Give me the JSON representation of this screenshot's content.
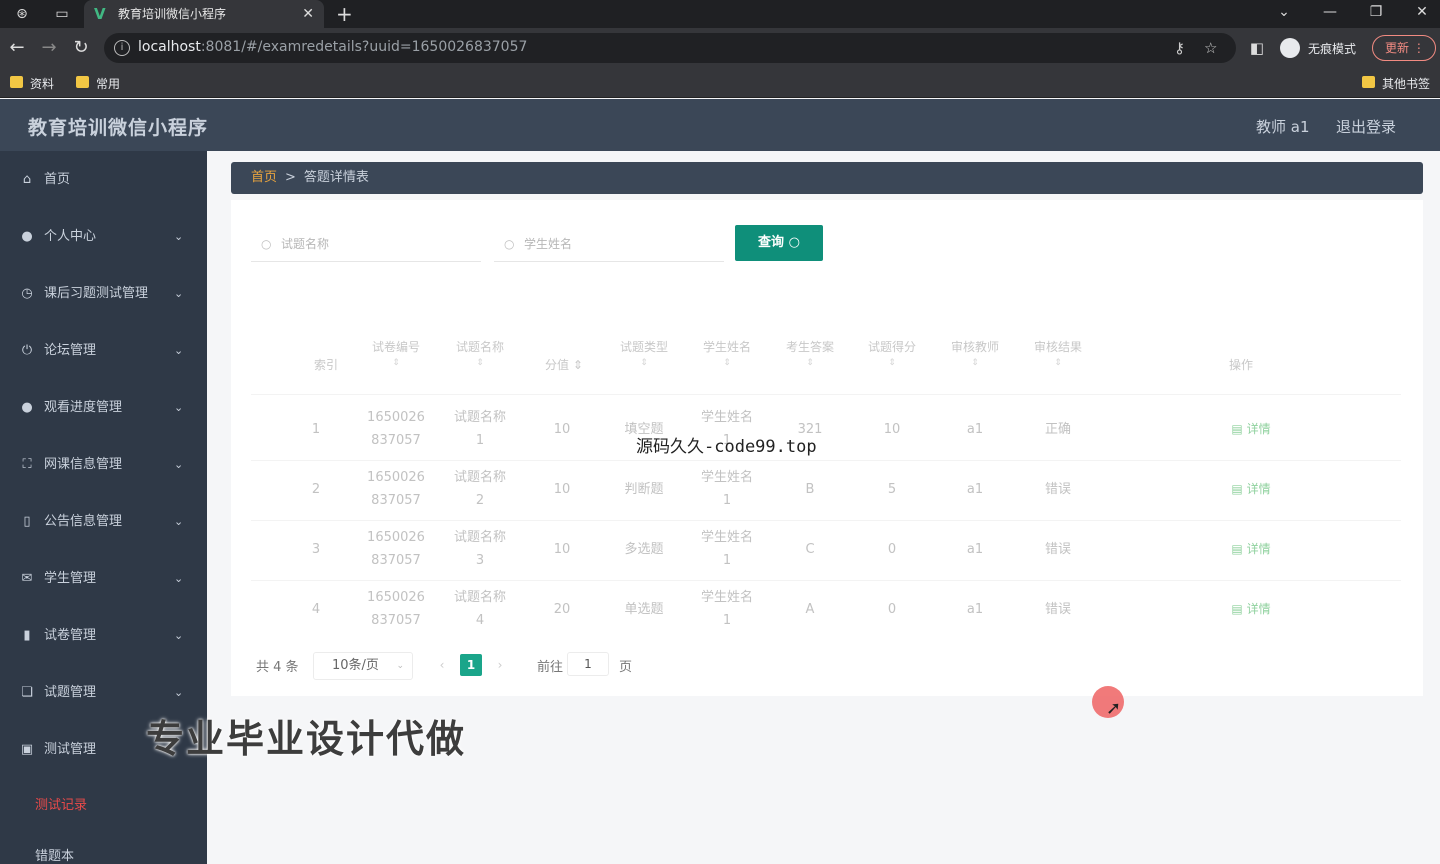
{
  "browser": {
    "tab_title": "教育培训微信小程序",
    "url_host": "localhost",
    "url_rest": ":8081/#/examredetails?uuid=1650026837057",
    "incognito_label": "无痕模式",
    "update_label": "更新",
    "bookmarks": [
      "资料",
      "常用"
    ],
    "other_bookmarks": "其他书签"
  },
  "header": {
    "title": "教育培训微信小程序",
    "user": "教师 a1",
    "logout": "退出登录"
  },
  "sidebar": {
    "items": [
      {
        "label": "首页"
      },
      {
        "label": "个人中心"
      },
      {
        "label": "课后习题测试管理"
      },
      {
        "label": "论坛管理"
      },
      {
        "label": "观看进度管理"
      },
      {
        "label": "网课信息管理"
      },
      {
        "label": "公告信息管理"
      },
      {
        "label": "学生管理"
      },
      {
        "label": "试卷管理"
      },
      {
        "label": "试题管理"
      },
      {
        "label": "测试管理"
      }
    ],
    "sub_items": [
      "测试记录",
      "错题本"
    ]
  },
  "breadcrumb": {
    "home": "首页",
    "sep": ">",
    "current": "答题详情表"
  },
  "search": {
    "question_placeholder": "试题名称",
    "student_placeholder": "学生姓名",
    "button": "查询"
  },
  "table": {
    "headers": [
      "索引",
      "试卷编号",
      "试题名称",
      "分值",
      "试题类型",
      "学生姓名",
      "考生答案",
      "试题得分",
      "审核教师",
      "审核结果",
      "操作"
    ],
    "rows": [
      {
        "index": "1",
        "paper_l1": "1650026",
        "paper_l2": "837057",
        "q_l1": "试题名称",
        "q_l2": "1",
        "score": "10",
        "type": "填空题",
        "stu_l1": "学生姓名",
        "stu_l2": "1",
        "answer": "321",
        "got": "10",
        "teacher": "a1",
        "result": "正确",
        "action": "详情"
      },
      {
        "index": "2",
        "paper_l1": "1650026",
        "paper_l2": "837057",
        "q_l1": "试题名称",
        "q_l2": "2",
        "score": "10",
        "type": "判断题",
        "stu_l1": "学生姓名",
        "stu_l2": "1",
        "answer": "B",
        "got": "5",
        "teacher": "a1",
        "result": "错误",
        "action": "详情"
      },
      {
        "index": "3",
        "paper_l1": "1650026",
        "paper_l2": "837057",
        "q_l1": "试题名称",
        "q_l2": "3",
        "score": "10",
        "type": "多选题",
        "stu_l1": "学生姓名",
        "stu_l2": "1",
        "answer": "C",
        "got": "0",
        "teacher": "a1",
        "result": "错误",
        "action": "详情"
      },
      {
        "index": "4",
        "paper_l1": "1650026",
        "paper_l2": "837057",
        "q_l1": "试题名称",
        "q_l2": "4",
        "score": "20",
        "type": "单选题",
        "stu_l1": "学生姓名",
        "stu_l2": "1",
        "answer": "A",
        "got": "0",
        "teacher": "a1",
        "result": "错误",
        "action": "详情"
      }
    ]
  },
  "pagination": {
    "total": "共 4 条",
    "page_size": "10条/页",
    "current": "1",
    "goto_prefix": "前往",
    "goto_value": "1",
    "goto_suffix": "页"
  },
  "watermarks": {
    "top": "源码久久-code99.top",
    "bottom": "专业毕业设计代做"
  }
}
